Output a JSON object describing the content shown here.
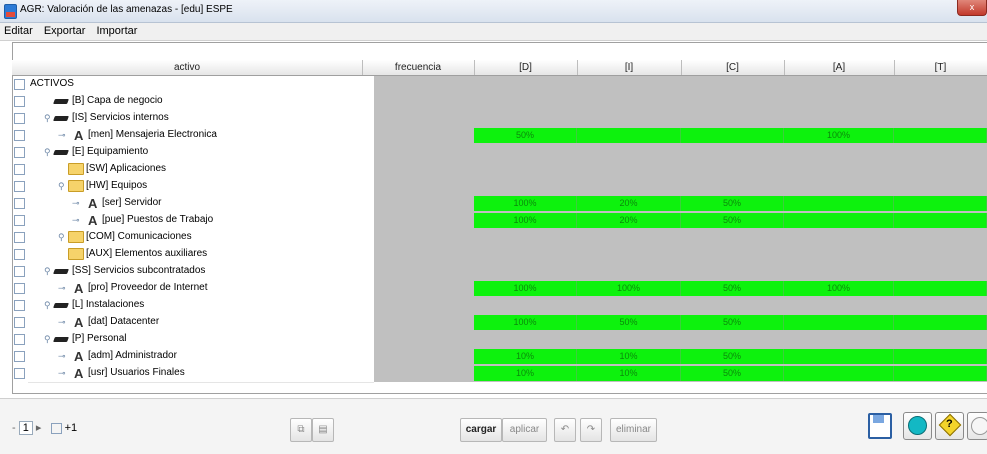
{
  "window": {
    "title": "AGR: Valoración de las amenazas - [edu] ESPE",
    "close": "x"
  },
  "menu": [
    "Editar",
    "Exportar",
    "Importar"
  ],
  "columns": [
    "activo",
    "frecuencia",
    "[D]",
    "[I]",
    "[C]",
    "[A]",
    "[T]"
  ],
  "rows": [
    {
      "label": "ACTIVOS",
      "icon": "none",
      "values": [],
      "indent": 0
    },
    {
      "label": "[B] Capa de negocio",
      "icon": "layer-icon",
      "values": [],
      "indent": 1
    },
    {
      "label": "[IS] Servicios internos",
      "icon": "layer-icon",
      "values": [],
      "indent": 1,
      "expand": true
    },
    {
      "label": "[men] Mensajeria Electronica",
      "icon": "asset-icon",
      "values": [
        "50%",
        "",
        "",
        "100%",
        ""
      ],
      "indent": 2
    },
    {
      "label": "[E] Equipamiento",
      "icon": "layer-icon",
      "values": [],
      "indent": 1,
      "expand": true
    },
    {
      "label": "[SW] Aplicaciones",
      "icon": "folder-icon",
      "values": [],
      "indent": 2
    },
    {
      "label": "[HW] Equipos",
      "icon": "folder-icon",
      "values": [],
      "indent": 2,
      "expand": true
    },
    {
      "label": "[ser] Servidor",
      "icon": "asset-icon",
      "values": [
        "100%",
        "20%",
        "50%",
        "",
        ""
      ],
      "indent": 3
    },
    {
      "label": "[pue] Puestos de Trabajo",
      "icon": "asset-icon",
      "values": [
        "100%",
        "20%",
        "50%",
        "",
        ""
      ],
      "indent": 3
    },
    {
      "label": "[COM] Comunicaciones",
      "icon": "folder-icon",
      "values": [],
      "indent": 2,
      "expand": true
    },
    {
      "label": "[AUX] Elementos auxiliares",
      "icon": "folder-icon",
      "values": [],
      "indent": 2
    },
    {
      "label": "[SS] Servicios subcontratados",
      "icon": "layer-icon",
      "values": [],
      "indent": 1,
      "expand": true
    },
    {
      "label": "[pro] Proveedor de Internet",
      "icon": "asset-icon",
      "values": [
        "100%",
        "100%",
        "50%",
        "100%",
        ""
      ],
      "indent": 2
    },
    {
      "label": "[L] Instalaciones",
      "icon": "layer-icon",
      "values": [],
      "indent": 1,
      "expand": true
    },
    {
      "label": "[dat] Datacenter",
      "icon": "asset-icon",
      "values": [
        "100%",
        "50%",
        "50%",
        "",
        ""
      ],
      "indent": 2
    },
    {
      "label": "[P] Personal",
      "icon": "layer-icon",
      "values": [],
      "indent": 1,
      "expand": true
    },
    {
      "label": "[adm] Administrador",
      "icon": "asset-icon",
      "values": [
        "10%",
        "10%",
        "50%",
        "",
        ""
      ],
      "indent": 2
    },
    {
      "label": "[usr] Usuarios Finales",
      "icon": "asset-icon",
      "values": [
        "10%",
        "10%",
        "50%",
        "",
        ""
      ],
      "indent": 2
    }
  ],
  "toolbar": {
    "level_value": "1",
    "level_plus": "+1",
    "cargar": "cargar",
    "aplicar": "aplicar",
    "eliminar": "eliminar"
  },
  "colors": {
    "value_cell": "#0df20d",
    "empty_area": "#c0c0c0"
  }
}
